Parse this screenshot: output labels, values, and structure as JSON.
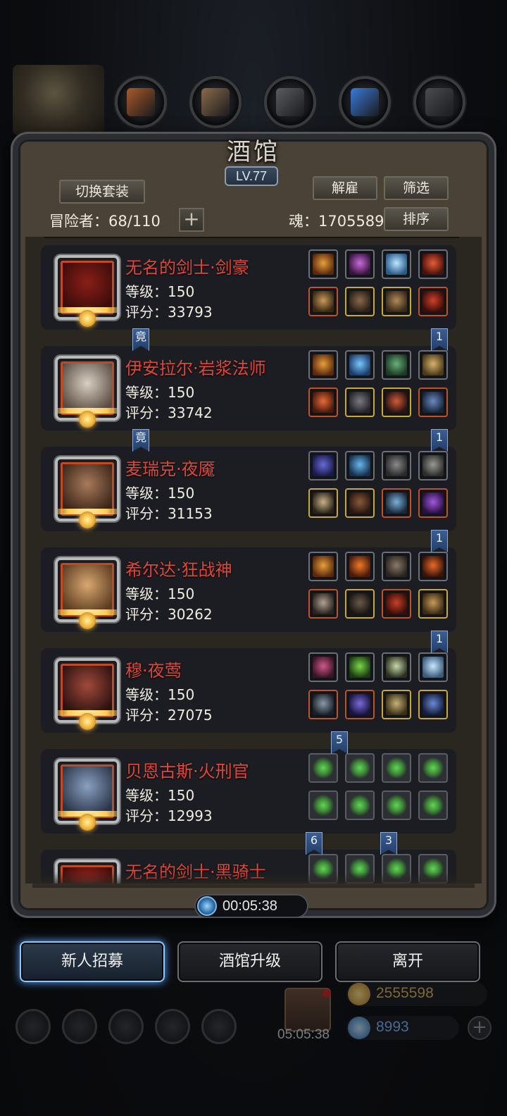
{
  "tavern": {
    "title": "酒馆",
    "level": "LV.77",
    "switch_outfit_label": "切换套装",
    "dismiss_label": "解雇",
    "filter_label": "筛选",
    "sort_label": "排序",
    "adventurer_label": "冒险者：68/110",
    "add_symbol": "+",
    "soul_label": "魂：1705589",
    "timer": "00:05:38"
  },
  "colors": {
    "name_red": "#e0463a",
    "frame_brown": "#4a4236",
    "card_bg": "#1b1d22",
    "active_glow": "#5aa6ff",
    "tag_blue": "#3b5e94"
  },
  "heroes": [
    {
      "name": "无名的剑士·剑豪",
      "level": "等级：150",
      "score": "评分：33793",
      "portrait_colors": [
        "#8a1e18",
        "#3a0c0a"
      ],
      "slots": [
        {
          "icon": "crown-flame-icon",
          "c1": "#e8a03a",
          "c2": "#5a2a0e",
          "border": "#6b6f76"
        },
        {
          "icon": "purple-crystal-icon",
          "c1": "#c86ad8",
          "c2": "#3a1440",
          "border": "#6b6f76"
        },
        {
          "icon": "blue-orb-icon",
          "c1": "#bfe6ff",
          "c2": "#2b5c8c",
          "border": "#6b6f76"
        },
        {
          "icon": "red-spiked-orb-icon",
          "c1": "#e85a3a",
          "c2": "#4a120c",
          "border": "#6b6f76"
        },
        {
          "icon": "dagger-icon",
          "c1": "#c89a5a",
          "c2": "#3a2814",
          "border": "#c0522a"
        },
        {
          "icon": "armor-icon",
          "c1": "#8a6a4a",
          "c2": "#2a2018",
          "border": "#c8a83a"
        },
        {
          "icon": "boots-icon",
          "c1": "#b08a5a",
          "c2": "#3a2a18",
          "border": "#c8a83a"
        },
        {
          "icon": "red-eye-icon",
          "c1": "#d0402a",
          "c2": "#3a0e0a",
          "border": "#c0522a"
        }
      ]
    },
    {
      "name": "伊安拉尔·岩浆法师",
      "level": "等级：150",
      "score": "评分：33742",
      "portrait_colors": [
        "#d8d0c4",
        "#5a4a40"
      ],
      "slots": [
        {
          "icon": "crown-flame-icon",
          "c1": "#e8a03a",
          "c2": "#5a2a0e",
          "border": "#6b6f76"
        },
        {
          "icon": "blue-orb-icon",
          "c1": "#7ac6ff",
          "c2": "#1a3c6a",
          "border": "#6b6f76"
        },
        {
          "icon": "green-orb-icon",
          "c1": "#6ab07a",
          "c2": "#1c3a24",
          "border": "#6b6f76"
        },
        {
          "icon": "compass-icon",
          "c1": "#d8b46a",
          "c2": "#4a3a1a",
          "border": "#6b6f76"
        },
        {
          "icon": "fire-staff-icon",
          "c1": "#e86a3a",
          "c2": "#4a1a0c",
          "border": "#c0522a"
        },
        {
          "icon": "robe-icon",
          "c1": "#7a7a80",
          "c2": "#24242a",
          "border": "#c8a83a"
        },
        {
          "icon": "ring-icon",
          "c1": "#d05a3a",
          "c2": "#2a1410",
          "border": "#c8a83a"
        },
        {
          "icon": "dragon-icon",
          "c1": "#6a8ac0",
          "c2": "#1a2438",
          "border": "#c0522a"
        }
      ]
    },
    {
      "name": "麦瑞克·夜魇",
      "level": "等级：150",
      "score": "评分：31153",
      "portrait_colors": [
        "#a87a5a",
        "#3a2418"
      ],
      "slots": [
        {
          "icon": "violet-mask-icon",
          "c1": "#6a6ad8",
          "c2": "#1a1a4a",
          "border": "#6b6f76"
        },
        {
          "icon": "blue-eye-icon",
          "c1": "#6ab8e8",
          "c2": "#143050",
          "border": "#6b6f76"
        },
        {
          "icon": "shield-icon",
          "c1": "#8a8a8a",
          "c2": "#2a2a2a",
          "border": "#6b6f76"
        },
        {
          "icon": "gauntlet-icon",
          "c1": "#9a9a94",
          "c2": "#2c2c2a",
          "border": "#6b6f76"
        },
        {
          "icon": "spear-icon",
          "c1": "#c8b08a",
          "c2": "#2a2418",
          "border": "#c8a83a"
        },
        {
          "icon": "cloak-icon",
          "c1": "#8a5a3a",
          "c2": "#2a1810",
          "border": "#c8a83a"
        },
        {
          "icon": "blade-icon",
          "c1": "#7ab0d8",
          "c2": "#1a2838",
          "border": "#c0522a"
        },
        {
          "icon": "purple-sigil-icon",
          "c1": "#a058e0",
          "c2": "#2a1040",
          "border": "#c0522a"
        }
      ]
    },
    {
      "name": "希尔达·狂战神",
      "level": "等级：150",
      "score": "评分：30262",
      "portrait_colors": [
        "#d8a870",
        "#5a3a20"
      ],
      "slots": [
        {
          "icon": "crown-flame-icon",
          "c1": "#e8a03a",
          "c2": "#5a2a0e",
          "border": "#6b6f76"
        },
        {
          "icon": "fire-orb-icon",
          "c1": "#f07a2a",
          "c2": "#4a1a0a",
          "border": "#6b6f76"
        },
        {
          "icon": "feather-icon",
          "c1": "#8a7a6a",
          "c2": "#2a2420",
          "border": "#6b6f76"
        },
        {
          "icon": "flame-skull-icon",
          "c1": "#e86a2a",
          "c2": "#3a140a",
          "border": "#6b6f76"
        },
        {
          "icon": "axe-icon",
          "c1": "#b0a090",
          "c2": "#2a2420",
          "border": "#c0522a"
        },
        {
          "icon": "dark-armor-icon",
          "c1": "#6a5a4a",
          "c2": "#1a1612",
          "border": "#c8a83a"
        },
        {
          "icon": "red-claw-icon",
          "c1": "#c8402a",
          "c2": "#3a0e08",
          "border": "#c0522a"
        },
        {
          "icon": "wood-totem-icon",
          "c1": "#c89a5a",
          "c2": "#3a2a14",
          "border": "#c8a83a"
        }
      ]
    },
    {
      "name": "穆·夜莺",
      "level": "等级：150",
      "score": "评分：27075",
      "portrait_colors": [
        "#a04a3a",
        "#2a1010"
      ],
      "slots": [
        {
          "icon": "pink-tiara-icon",
          "c1": "#d05a8a",
          "c2": "#3a1428",
          "border": "#6b6f76"
        },
        {
          "icon": "green-gem-icon",
          "c1": "#7ad84a",
          "c2": "#1a3a10",
          "border": "#6b6f76"
        },
        {
          "icon": "wand-icon",
          "c1": "#c8d8a8",
          "c2": "#2a3020",
          "border": "#6b6f76"
        },
        {
          "icon": "ice-crystal-icon",
          "c1": "#c8e8ff",
          "c2": "#3a5a7a",
          "border": "#6b6f76"
        },
        {
          "icon": "rifle-icon",
          "c1": "#8a9aa8",
          "c2": "#1a2028",
          "border": "#c0522a"
        },
        {
          "icon": "mage-robe-icon",
          "c1": "#7a6ad8",
          "c2": "#1a1440",
          "border": "#c0522a"
        },
        {
          "icon": "amulet-icon",
          "c1": "#c8b07a",
          "c2": "#3a3018",
          "border": "#c8a83a"
        },
        {
          "icon": "sword-icon",
          "c1": "#6a8ad8",
          "c2": "#141c3a",
          "border": "#c8a83a"
        }
      ]
    },
    {
      "name": "贝恩古斯·火刑官",
      "level": "等级：150",
      "score": "评分：12993",
      "portrait_colors": [
        "#8aa0c0",
        "#2a3448"
      ],
      "slots": [
        {
          "icon": "add-slot-icon",
          "empty": true
        },
        {
          "icon": "add-slot-icon",
          "empty": true
        },
        {
          "icon": "add-slot-icon",
          "empty": true
        },
        {
          "icon": "add-slot-icon",
          "empty": true
        },
        {
          "icon": "add-slot-icon",
          "empty": true
        },
        {
          "icon": "add-slot-icon",
          "empty": true
        },
        {
          "icon": "add-slot-icon",
          "empty": true
        },
        {
          "icon": "add-slot-icon",
          "empty": true
        }
      ]
    },
    {
      "name": "无名的剑士·黑骑士",
      "level": "",
      "score": "",
      "portrait_colors": [
        "#b02a24",
        "#3a0c0a"
      ],
      "slots": [
        {
          "icon": "add-slot-icon",
          "empty": true
        },
        {
          "icon": "add-slot-icon",
          "empty": true
        },
        {
          "icon": "add-slot-icon",
          "empty": true
        },
        {
          "icon": "add-slot-icon",
          "empty": true
        }
      ]
    }
  ],
  "tags": [
    {
      "text": "竟",
      "card": 0,
      "side": "left"
    },
    {
      "text": "1",
      "card": 0,
      "side": "right"
    },
    {
      "text": "竟",
      "card": 1,
      "side": "left"
    },
    {
      "text": "1",
      "card": 1,
      "side": "right"
    },
    {
      "text": "1",
      "card": 2,
      "side": "right"
    },
    {
      "text": "1",
      "card": 3,
      "side": "right"
    },
    {
      "text": "5",
      "card": 4,
      "side": "mid"
    },
    {
      "text": "6",
      "card": 5,
      "side": "midleft"
    },
    {
      "text": "3",
      "card": 5,
      "side": "midright"
    }
  ],
  "actions": {
    "recruit": "新人招募",
    "upgrade": "酒馆升级",
    "leave": "离开"
  },
  "hud": {
    "gift_timer": "05:05:38",
    "gold": "2555598",
    "gems": "8993",
    "add_symbol": "+",
    "icons": [
      "settings-gear-icon",
      "star-badge-icon",
      "castle-icon",
      "mail-icon",
      "hexagon-icon"
    ]
  },
  "topnav": {
    "icons": [
      "bronze-shield-icon",
      "wooden-plank-icon",
      "steel-stairs-icon",
      "blue-crystal-icon",
      "dark-steps-icon"
    ]
  }
}
